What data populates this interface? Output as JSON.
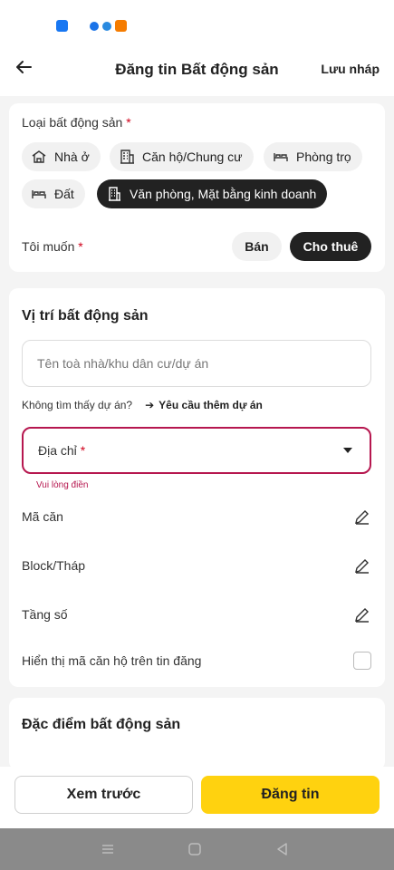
{
  "header": {
    "title": "Đăng tin Bất động sản",
    "save_draft": "Lưu nháp"
  },
  "property_type": {
    "label": "Loại bất động sản",
    "required_mark": "*",
    "options": [
      {
        "label": "Nhà ở",
        "icon": "house-icon",
        "active": false
      },
      {
        "label": "Căn hộ/Chung cư",
        "icon": "building-icon",
        "active": false
      },
      {
        "label": "Phòng trọ",
        "icon": "bed-icon",
        "active": false
      },
      {
        "label": "Đất",
        "icon": "bed-icon",
        "active": false
      },
      {
        "label": "Văn phòng, Mặt bằng kinh doanh",
        "icon": "office-icon",
        "active": true
      }
    ]
  },
  "intent": {
    "label": "Tôi muốn",
    "required_mark": "*",
    "options": [
      "Bán",
      "Cho thuê"
    ],
    "selected": "Cho thuê"
  },
  "location": {
    "title": "Vị trí bất động sản",
    "project_placeholder": "Tên toà nhà/khu dân cư/dự án",
    "not_found": "Không tìm thấy dự án?",
    "request_link": "Yêu cầu thêm dự án",
    "address_label": "Địa chỉ",
    "required_mark": "*",
    "error": "Vui lòng điền",
    "fields": [
      "Mã căn",
      "Block/Tháp",
      "Tầng số"
    ],
    "show_code_label": "Hiển thị mã căn hộ trên tin đăng"
  },
  "features": {
    "title": "Đặc điểm bất động sản"
  },
  "actions": {
    "preview": "Xem trước",
    "post": "Đăng tin"
  },
  "colors": {
    "accent": "#ffd20f",
    "error": "#b6174f",
    "active_chip": "#222222"
  }
}
